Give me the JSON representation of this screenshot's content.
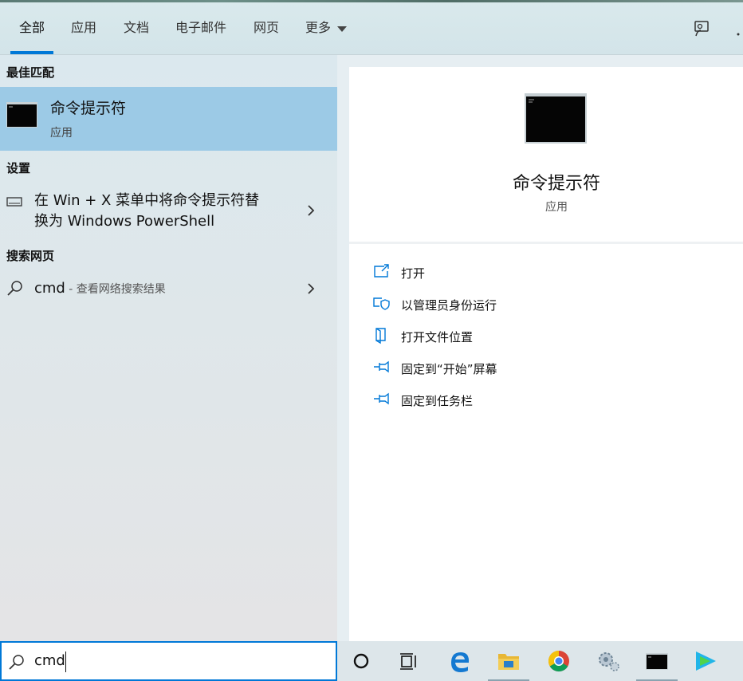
{
  "tabs": [
    {
      "label": "全部",
      "active": true
    },
    {
      "label": "应用"
    },
    {
      "label": "文档"
    },
    {
      "label": "电子邮件"
    },
    {
      "label": "网页"
    },
    {
      "label": "更多"
    }
  ],
  "header_icons": [
    "feedback-icon",
    "more-options-icon"
  ],
  "sections": {
    "best_match": "最佳匹配",
    "settings": "设置",
    "web": "搜索网页"
  },
  "best_match": {
    "title": "命令提示符",
    "subtitle": "应用",
    "icon": "command-prompt-icon"
  },
  "settings_result": {
    "line1": "在 Win + X 菜单中将命令提示符替",
    "line2": "换为 Windows PowerShell",
    "icon": "keyboard-icon"
  },
  "web_result": {
    "query": "cmd",
    "suffix": " - 查看网络搜索结果",
    "icon": "search-icon"
  },
  "detail": {
    "title": "命令提示符",
    "subtitle": "应用",
    "actions": [
      {
        "label": "打开",
        "icon": "open-icon"
      },
      {
        "label": "以管理员身份运行",
        "icon": "run-as-admin-icon"
      },
      {
        "label": "打开文件位置",
        "icon": "file-location-icon"
      },
      {
        "label": "固定到“开始”屏幕",
        "icon": "pin-icon"
      },
      {
        "label": "固定到任务栏",
        "icon": "pin-icon"
      }
    ]
  },
  "search": {
    "value": "cmd"
  },
  "taskbar": [
    "cortana-icon",
    "task-view-icon",
    "edge-icon",
    "file-explorer-icon",
    "chrome-icon",
    "settings-icon",
    "command-prompt-icon",
    "video-app-icon"
  ],
  "colors": {
    "accent": "#0078d7",
    "selected": "#9ccae6"
  }
}
